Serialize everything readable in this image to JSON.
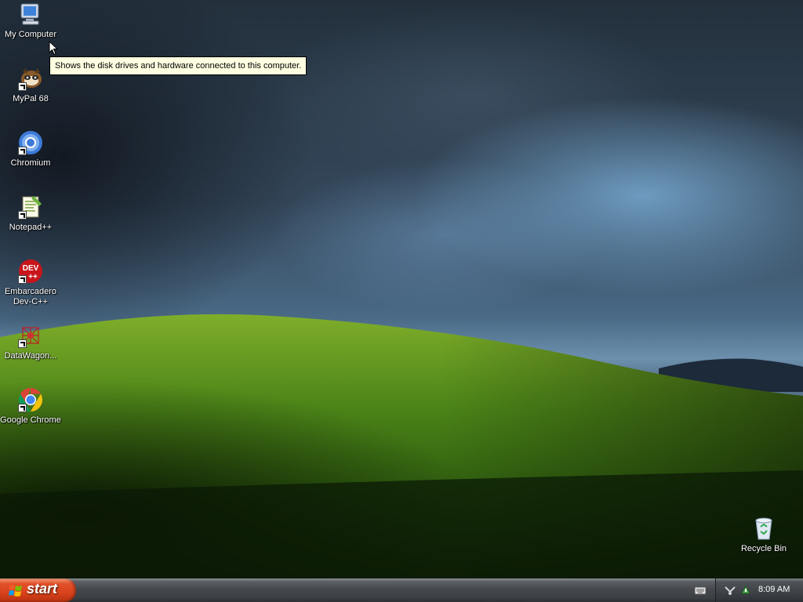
{
  "desktop": {
    "icons": [
      {
        "label": "My Computer",
        "icon": "my-computer-icon"
      },
      {
        "label": "MyPal 68",
        "icon": "mypal-icon"
      },
      {
        "label": "Chromium",
        "icon": "chromium-icon"
      },
      {
        "label": "Notepad++",
        "icon": "notepad-plus-plus-icon"
      },
      {
        "label": "Embarcadero\nDev-C++",
        "icon": "dev-cpp-icon"
      },
      {
        "label": "DataWagon...",
        "icon": "datawagon-icon"
      },
      {
        "label": "Google Chrome",
        "icon": "google-chrome-icon"
      },
      {
        "label": "Recycle Bin",
        "icon": "recycle-bin-icon"
      }
    ],
    "tooltip": "Shows the disk drives and hardware connected to this computer."
  },
  "taskbar": {
    "start_label": "start",
    "clock": "8:09 AM",
    "tray_icons": [
      "keyboard-icon",
      "network-icon",
      "safely-remove-icon"
    ]
  },
  "colors": {
    "start_button": "#d9431d",
    "taskbar": "#3c3f43",
    "tooltip_bg": "#ffffe1"
  }
}
